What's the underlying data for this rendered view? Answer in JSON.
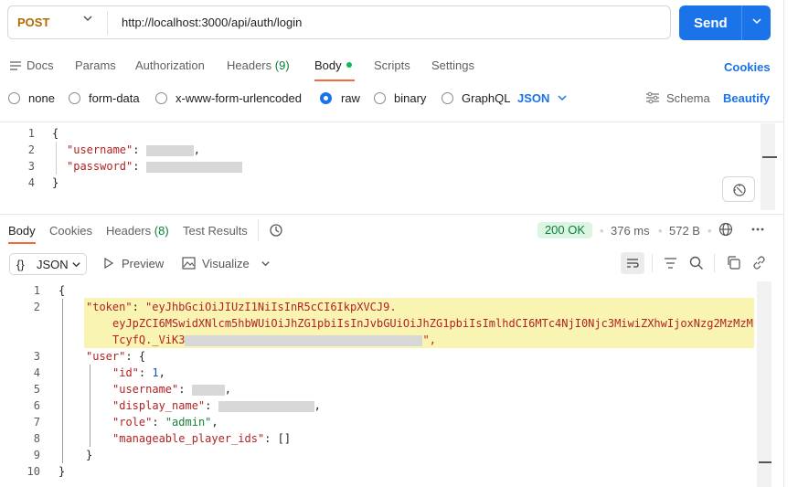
{
  "request": {
    "method": "POST",
    "url": "http://localhost:3000/api/auth/login",
    "send_label": "Send"
  },
  "request_tabs": {
    "docs": "Docs",
    "params": "Params",
    "authorization": "Authorization",
    "headers": "Headers",
    "headers_count": "(9)",
    "body": "Body",
    "scripts": "Scripts",
    "settings": "Settings",
    "cookies": "Cookies"
  },
  "body_types": {
    "none": "none",
    "form_data": "form-data",
    "urlencoded": "x-www-form-urlencoded",
    "raw": "raw",
    "binary": "binary",
    "graphql": "GraphQL",
    "format": "JSON",
    "schema": "Schema",
    "beautify": "Beautify",
    "selected": "raw"
  },
  "request_body": {
    "lines": [
      "1",
      "2",
      "3",
      "4"
    ],
    "open": "{",
    "username_key": "\"username\"",
    "password_key": "\"password\"",
    "colon": ":",
    "comma": ",",
    "close": "}"
  },
  "response_tabs": {
    "body": "Body",
    "cookies": "Cookies",
    "headers": "Headers",
    "headers_count": "(8)",
    "test_results": "Test Results",
    "status": "200 OK",
    "time": "376 ms",
    "size": "572 B"
  },
  "response_toolbar": {
    "format_icon": "{}",
    "format": "JSON",
    "preview": "Preview",
    "visualize": "Visualize"
  },
  "response_body": {
    "lines": [
      "1",
      "2",
      "",
      "",
      "3",
      "4",
      "5",
      "6",
      "7",
      "8",
      "9",
      "10"
    ],
    "open": "{",
    "token_key": "\"token\"",
    "token_line1": "\"eyJhbGciOiJIUzI1NiIsInR5cCI6IkpXVCJ9.",
    "token_line2": "eyJpZCI6MSwidXNlcm5hbWUiOiJhZG1pbiIsInJvbGUiOiJhZG1pbiIsImlhdCI6MTc4NjI0Njc3MiwiZXhwIjoxNzg2MzMzM",
    "token_line3": "TcyfQ._ViK3",
    "token_end": "\",",
    "user_key": "\"user\"",
    "id_key": "\"id\"",
    "id_value": "1",
    "username_key": "\"username\"",
    "display_name_key": "\"display_name\"",
    "role_key": "\"role\"",
    "role_value": "\"admin\"",
    "players_key": "\"manageable_player_ids\"",
    "players_value": "[]",
    "colon": ":",
    "comma": ",",
    "brace_open": "{",
    "inner_close": "}",
    "close": "}"
  }
}
